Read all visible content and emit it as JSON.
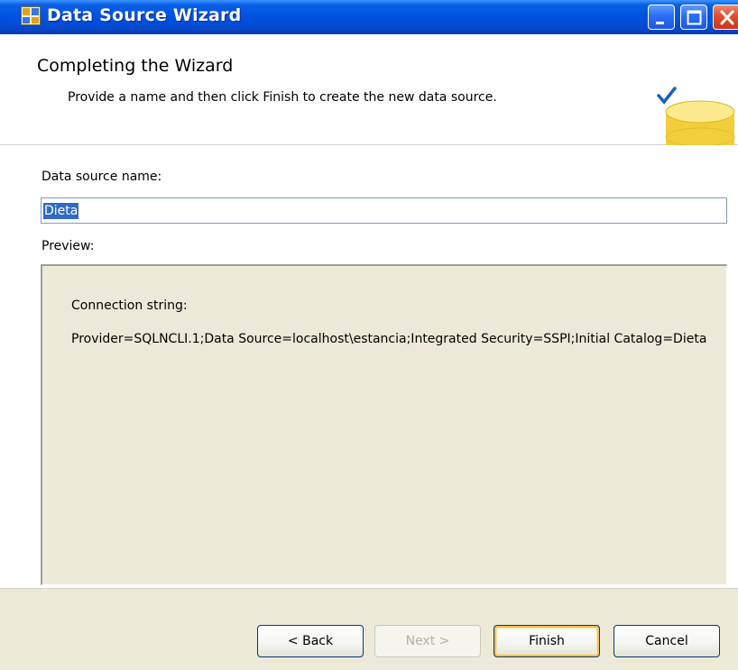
{
  "window": {
    "title": "Data Source Wizard"
  },
  "header": {
    "title": "Completing the Wizard",
    "subtitle": "Provide a name and then click Finish to create the new data source."
  },
  "form": {
    "name_label": "Data source name:",
    "name_value": "Dieta",
    "preview_label": "Preview:",
    "connection_label": "Connection string:",
    "connection_value": "Provider=SQLNCLI.1;Data Source=localhost\\estancia;Integrated Security=SSPI;Initial Catalog=Dieta"
  },
  "buttons": {
    "back": "< Back",
    "next": "Next >",
    "finish": "Finish",
    "cancel": "Cancel"
  },
  "icons": {
    "app": "data-source-wizard-icon",
    "header_art": "database-checkmark-icon",
    "minimize": "minimize-icon",
    "maximize": "maximize-icon",
    "close": "close-icon"
  },
  "colors": {
    "titlebar": "#0053e1",
    "selection": "#316ac5",
    "dialog_face": "#ece9d8",
    "close_button": "#e0502e"
  }
}
